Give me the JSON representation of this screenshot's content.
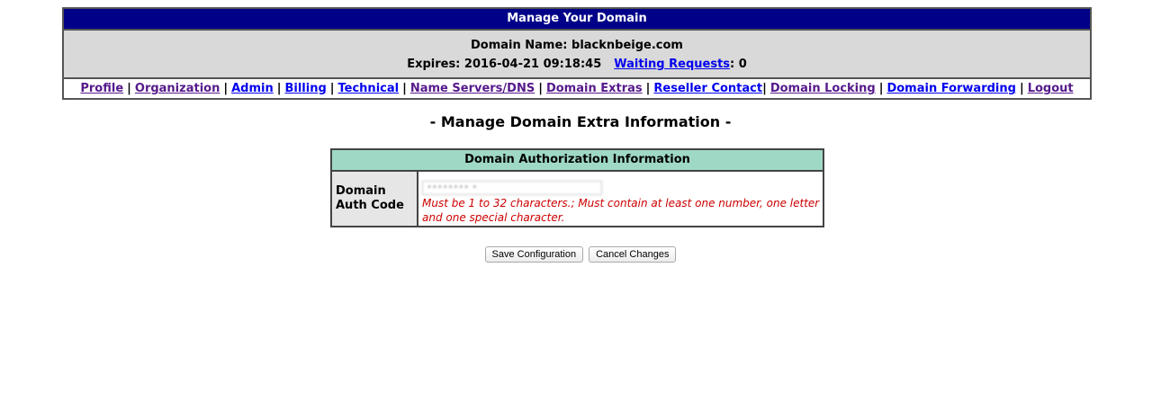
{
  "header": {
    "title": "Manage Your Domain",
    "domain_name_line": "Domain Name: blacknbeige.com",
    "expires_text": "Expires: 2016-04-21 09:18:45",
    "waiting_requests_label": "Waiting Requests",
    "waiting_requests_count": ": 0"
  },
  "nav": {
    "items": [
      {
        "label": "Profile",
        "visited": true
      },
      {
        "label": "Organization",
        "visited": true
      },
      {
        "label": "Admin",
        "visited": false
      },
      {
        "label": "Billing",
        "visited": false
      },
      {
        "label": "Technical",
        "visited": false
      },
      {
        "label": "Name Servers/DNS",
        "visited": true
      },
      {
        "label": "Domain Extras",
        "visited": true
      },
      {
        "label": "Reseller Contact",
        "visited": false
      },
      {
        "label": "Domain Locking",
        "visited": true
      },
      {
        "label": "Domain Forwarding",
        "visited": false
      },
      {
        "label": "Logout",
        "visited": true
      }
    ]
  },
  "main": {
    "heading": "- Manage Domain Extra Information -"
  },
  "auth_table": {
    "title": "Domain Authorization Information",
    "label_line1": "Domain",
    "label_line2": "Auth Code",
    "input_value": "•••••••• •",
    "error_text": "Must be 1 to 32 characters.; Must contain at least one number, one letter and one special character."
  },
  "buttons": {
    "save_label": "Save Configuration",
    "cancel_label": "Cancel Changes"
  },
  "colors": {
    "header_bg": "#000088",
    "info_bg": "#d9d9d9",
    "table_header_bg": "#9fd9c5",
    "error_color": "#cc0000",
    "link_color": "#0000ee",
    "visited_link_color": "#551a8b"
  }
}
